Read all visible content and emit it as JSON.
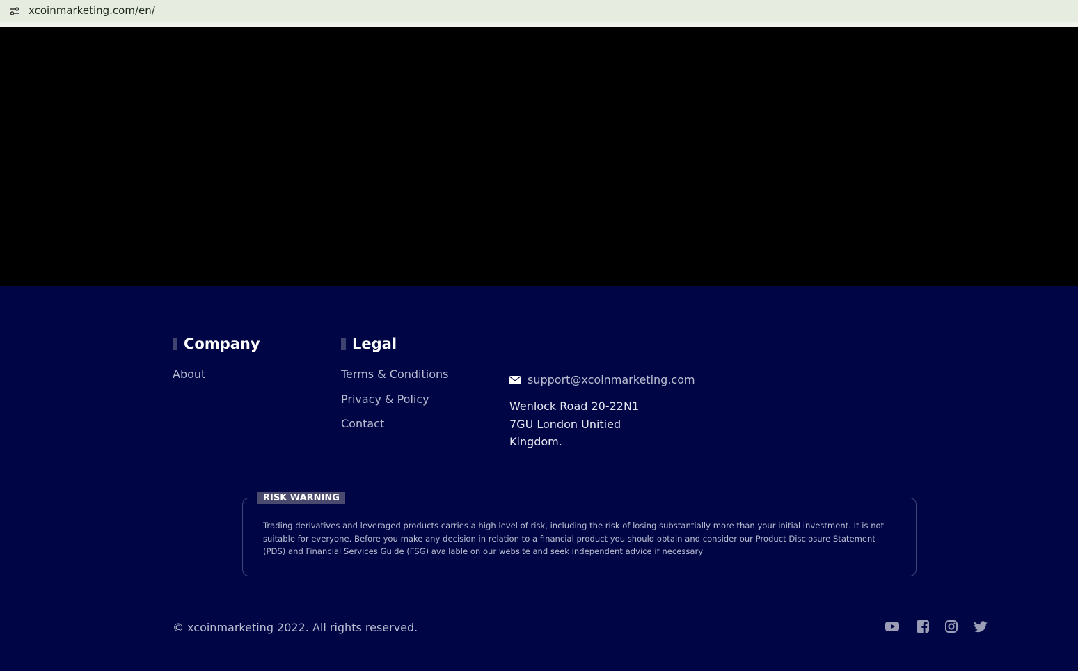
{
  "browser": {
    "url": "xcoinmarketing.com/en/"
  },
  "footer": {
    "company": {
      "heading": "Company",
      "links": [
        "About"
      ]
    },
    "legal": {
      "heading": "Legal",
      "links": [
        "Terms & Conditions",
        "Privacy & Policy",
        "Contact"
      ]
    },
    "contact": {
      "email": "support@xcoinmarketing.com",
      "address_lines": [
        "Wenlock Road 20-22N1",
        "7GU London Unitied",
        "Kingdom."
      ]
    },
    "risk_warning": {
      "label": "RISK WARNING",
      "text": "Trading derivatives and leveraged products carries a high level of risk, including the risk of losing substantially more than your initial investment. It is not suitable for everyone. Before you make any decision in relation to a financial product you should obtain and consider our Product Disclosure Statement (PDS) and Financial Services Guide (FSG) available on our website and seek independent advice if necessary"
    },
    "copyright": "© xcoinmarketing 2022. All rights reserved.",
    "social_icons": [
      "youtube-icon",
      "facebook-icon",
      "instagram-icon",
      "twitter-icon"
    ]
  },
  "colors": {
    "footer_bg": "#000645",
    "hero_bg": "#000000",
    "link": "#b9bcd0",
    "heading": "#ffffff",
    "accent_bar": "#3d4270"
  }
}
